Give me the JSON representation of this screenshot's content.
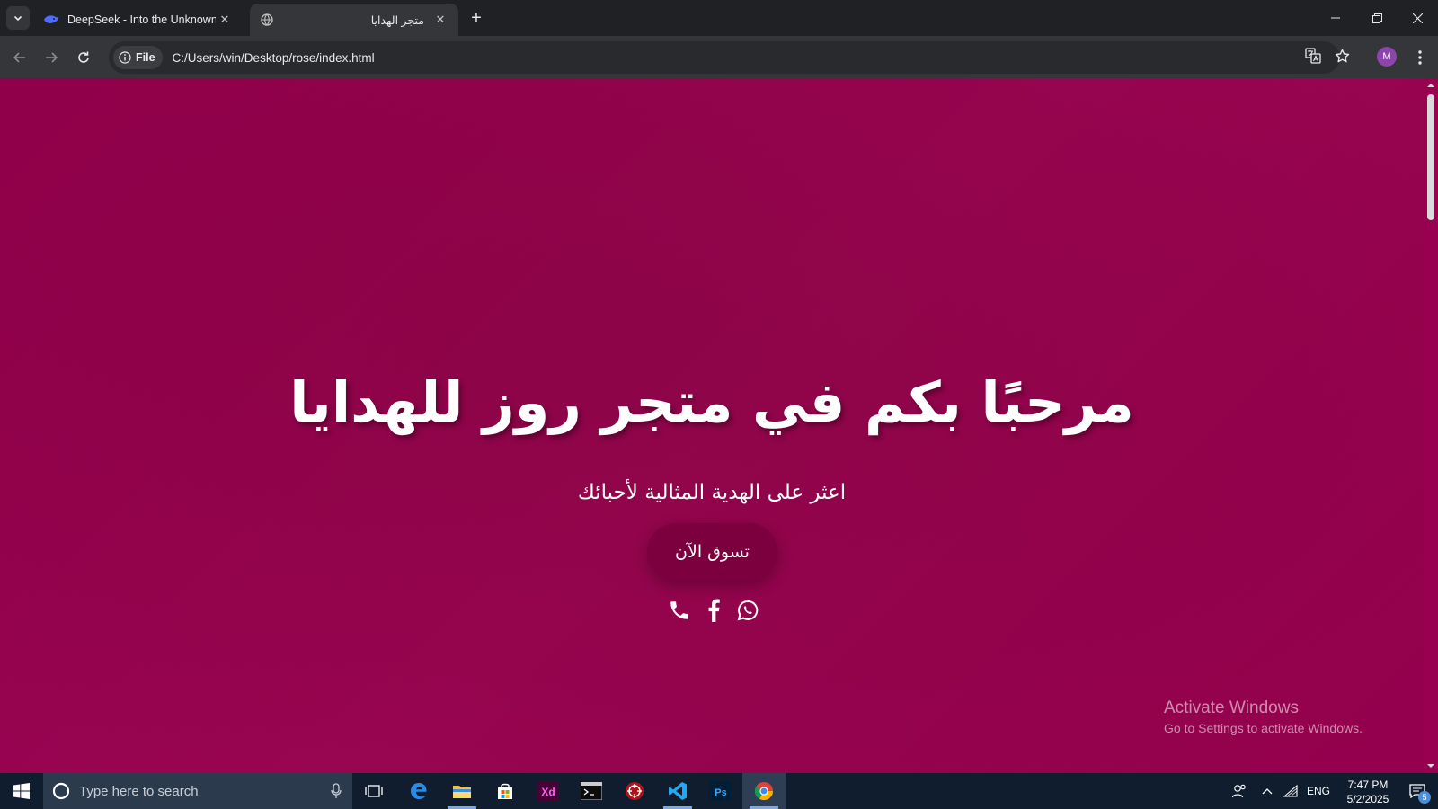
{
  "browser": {
    "tabs": [
      {
        "title": "DeepSeek - Into the Unknown",
        "favicon": "deepseek-whale-icon",
        "active": false
      },
      {
        "title": "متجر الهدايا",
        "favicon": "globe-icon",
        "active": true
      }
    ],
    "address_chip": "File",
    "url": "C:/Users/win/Desktop/rose/index.html",
    "profile_initial": "M",
    "accent_color": "#8e44ad"
  },
  "page": {
    "hero_title": "مرحبًا بكم في متجر روز للهدايا",
    "hero_subtitle": "اعثر على الهدية المثالية لأحبائك",
    "cta_label": "تسوق الآن",
    "social_icons": [
      "phone-icon",
      "facebook-icon",
      "whatsapp-icon"
    ],
    "background_color": "#93004b",
    "button_color": "#7d003e"
  },
  "watermark": {
    "title": "Activate Windows",
    "subtitle": "Go to Settings to activate Windows."
  },
  "taskbar": {
    "search_placeholder": "Type here to search",
    "apps": [
      "task-view-icon",
      "edge-icon",
      "file-explorer-icon",
      "store-icon",
      "adobe-xd-icon",
      "terminal-icon",
      "security-app-icon",
      "vscode-icon",
      "photoshop-icon",
      "chrome-icon"
    ],
    "language": "ENG",
    "time": "7:47 PM",
    "date": "5/2/2025",
    "notification_count": "5"
  }
}
